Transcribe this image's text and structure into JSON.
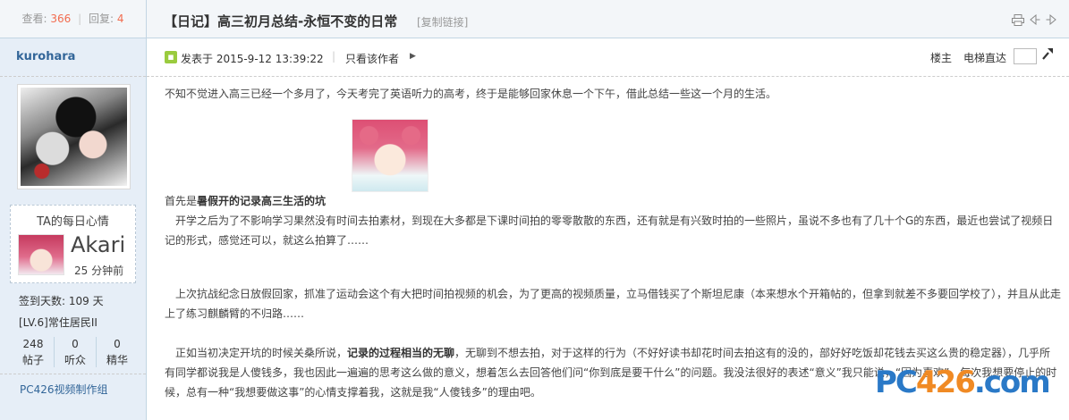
{
  "stats": {
    "views_label": "查看:",
    "views": "366",
    "sep": "|",
    "replies_label": "回复:",
    "replies": "4"
  },
  "author": {
    "name": "kurohara"
  },
  "mood": {
    "title": "TA的每日心情",
    "name": "Akari",
    "time": "25 分钟前"
  },
  "profile": {
    "checkin": "签到天数: 109 天",
    "level": "[LV.6]常住居民II",
    "counts": [
      {
        "value": "248",
        "label": "帖子"
      },
      {
        "value": "0",
        "label": "听众"
      },
      {
        "value": "0",
        "label": "精华"
      }
    ],
    "group": "PC426视频制作组"
  },
  "post": {
    "title": "【日记】高三初月总结-永恒不变的日常",
    "copy_link": "[复制链接]",
    "posted": "发表于 2015-9-12 13:39:22",
    "meta_sep": "|",
    "only_author": "只看该作者",
    "floor": "楼主",
    "jump_label": "电梯直达",
    "paragraphs": {
      "p1": "不知不觉进入高三已经一个多月了，今天考完了英语听力的高考，终于是能够回家休息一个下午，借此总结一些这一个月的生活。",
      "p2_plain": "首先是",
      "p2_bold": "暑假开的记录高三生活的坑",
      "p3": "　开学之后为了不影响学习果然没有时间去拍素材，到现在大多都是下课时间拍的零零散散的东西，还有就是有兴致时拍的一些照片，虽说不多也有了几十个G的东西，最近也尝试了视频日记的形式，感觉还可以，就这么拍算了……",
      "p4": "　上次抗战纪念日放假回家，抓准了运动会这个有大把时间拍视频的机会，为了更高的视频质量，立马借钱买了个斯坦尼康（本来想水个开箱帖的，但拿到就差不多要回学校了），并且从此走上了练习麒麟臂的不归路……",
      "p5_a": "　正如当初决定开坑的时候关桑所说，",
      "p5_bold": "记录的过程相当的无聊",
      "p5_b": "，无聊到不想去拍，对于这样的行为（不好好读书却花时间去拍这有的没的，部好好吃饭却花钱去买这么贵的稳定器），几乎所有同学都说我是人傻钱多，我也因此一遍遍的思考这么做的意义，想着怎么去回答他们问“你到底是要干什么”的问题。我没法很好的表述“意义”我只能说，“因为喜欢”。每次我想要停止的时候，总有一种“我想要做这事”的心情支撑着我，这就是我“人傻钱多”的理由吧。"
    }
  },
  "watermark": {
    "part1": "PC",
    "part2": "426",
    "part3": ".com"
  },
  "icons": [
    "print-icon",
    "prev-thread-icon",
    "next-thread-icon",
    "jump-go-icon",
    "online-status-icon",
    "play-arrow-icon"
  ]
}
